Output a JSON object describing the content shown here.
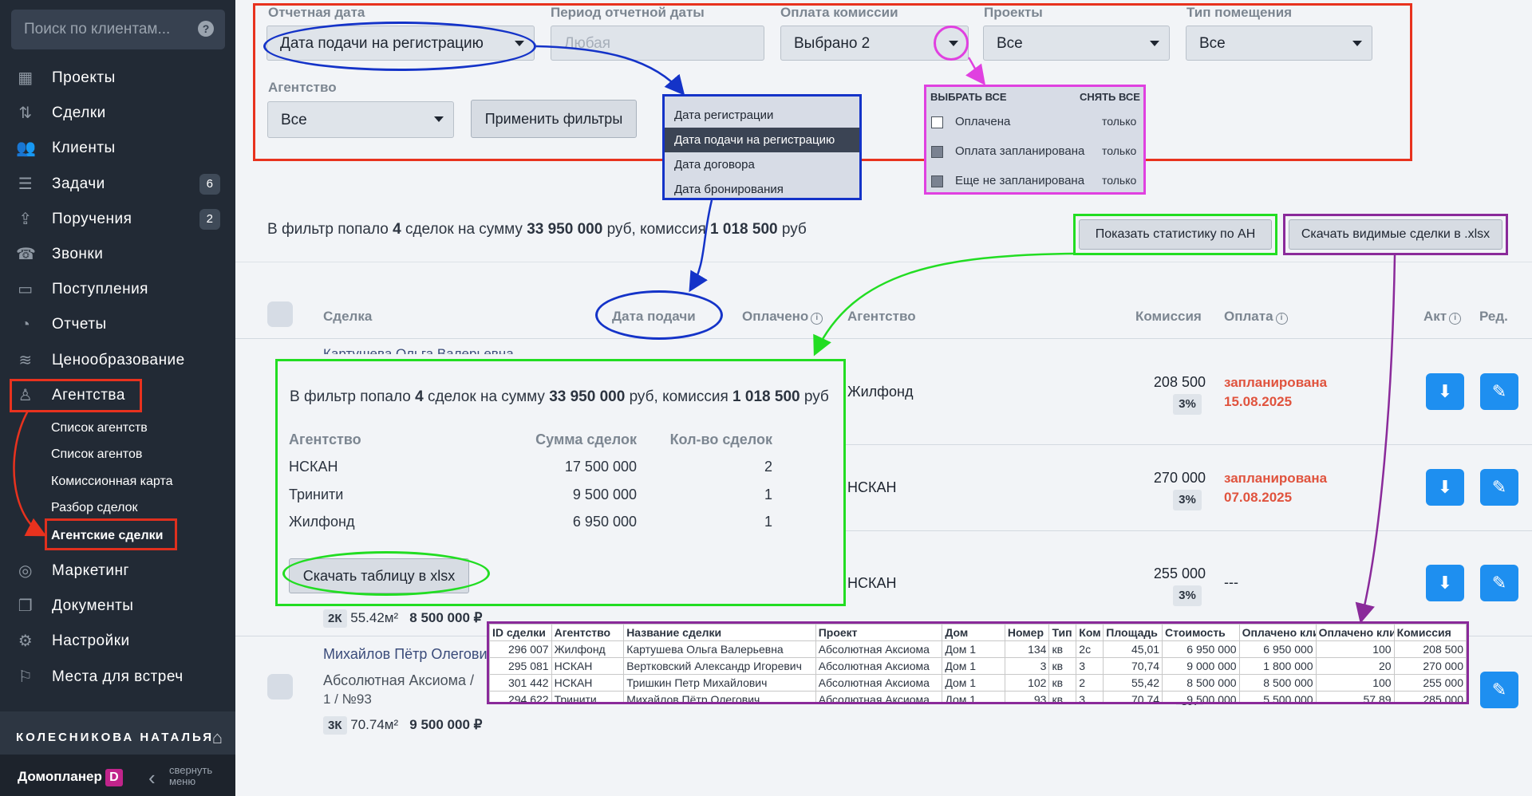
{
  "sidebar": {
    "search_placeholder": "Поиск по клиентам...",
    "help": "?",
    "items": [
      {
        "label": "Проекты",
        "icon": "grid-icon",
        "glyph": "▦"
      },
      {
        "label": "Сделки",
        "icon": "deals-icon",
        "glyph": "⇅"
      },
      {
        "label": "Клиенты",
        "icon": "users-icon",
        "glyph": "👥"
      },
      {
        "label": "Задачи",
        "icon": "tasks-icon",
        "glyph": "☰",
        "count": "6"
      },
      {
        "label": "Поручения",
        "icon": "inbox-icon",
        "glyph": "⇪",
        "count": "2"
      },
      {
        "label": "Звонки",
        "icon": "calls-icon",
        "glyph": "☎"
      },
      {
        "label": "Поступления",
        "icon": "wallet-icon",
        "glyph": "▭"
      },
      {
        "label": "Отчеты",
        "icon": "reports-icon",
        "glyph": "◔"
      },
      {
        "label": "Ценообразование",
        "icon": "coins-icon",
        "glyph": "≋"
      },
      {
        "label": "Агентства",
        "icon": "agency-icon",
        "glyph": "♙"
      }
    ],
    "agency_sub": [
      "Список агентств",
      "Список агентов",
      "Комиссионная карта",
      "Разбор сделок",
      "Агентские сделки"
    ],
    "items2": [
      {
        "label": "Маркетинг",
        "icon": "target-icon",
        "glyph": "◎"
      },
      {
        "label": "Документы",
        "icon": "documents-icon",
        "glyph": "❐"
      },
      {
        "label": "Настройки",
        "icon": "gear-icon",
        "glyph": "⚙"
      },
      {
        "label": "Места для встреч",
        "icon": "meeting-icon",
        "glyph": "⚐"
      }
    ],
    "user": "КОЛЕСНИКОВА НАТАЛЬЯ",
    "brand": "Домопланер",
    "brand_logo": "D",
    "collapse": "свернуть меню"
  },
  "filters": {
    "report_date_label": "Отчетная дата",
    "report_date_value": "Дата подачи на регистрацию",
    "period_label": "Период отчетной даты",
    "period_placeholder": "Любая",
    "commission_label": "Оплата комиссии",
    "commission_value": "Выбрано 2",
    "projects_label": "Проекты",
    "projects_value": "Все",
    "room_label": "Тип помещения",
    "room_value": "Все",
    "agency_label": "Агентство",
    "agency_value": "Все",
    "apply": "Применить фильтры"
  },
  "date_dropdown": [
    "Дата регистрации",
    "Дата подачи на регистрацию",
    "Дата договора",
    "Дата бронирования"
  ],
  "pay_dropdown": {
    "select_all": "ВЫБРАТЬ ВСЕ",
    "clear_all": "СНЯТЬ ВСЕ",
    "only": "только",
    "items": [
      "Оплачена",
      "Оплата запланирована",
      "Еще не запланирована"
    ]
  },
  "summary": {
    "pre": "В фильтр попало ",
    "count": "4",
    "mid": " сделок на сумму ",
    "sum": "33 950 000",
    "mid2": " руб, комиссия ",
    "commission": "1 018 500",
    "post": " руб"
  },
  "stats_btn": "Показать статистику по АН",
  "xlsx_btn": "Скачать видимые сделки в .xlsx",
  "columns": {
    "deal": "Сделка",
    "date": "Дата подачи",
    "paid": "Оплачено",
    "agency": "Агентство",
    "commission": "Комиссия",
    "payment": "Оплата",
    "act": "Акт",
    "edit": "Ред."
  },
  "rows": [
    {
      "agency": "Жилфонд",
      "commission": "208 500",
      "pct": "3%",
      "status": "запланирована",
      "date": "15.08.2025"
    },
    {
      "agency": "НСКАН",
      "commission": "270 000",
      "pct": "3%",
      "status": "запланирована",
      "date": "07.08.2025"
    },
    {
      "agency": "НСКАН",
      "commission": "255 000",
      "pct": "3%",
      "status": "---",
      "date": ""
    }
  ],
  "row0_name_partial": "Картушева Ольга Валерьевна",
  "row3": {
    "rooms": "2К",
    "area": "55.42м²",
    "price": "8 500 000 ₽"
  },
  "row4": {
    "name": "Михайлов Пётр Олегович",
    "project": "Абсолютная Аксиома   /",
    "sub": "1  /  №93",
    "rooms": "3К",
    "area": "70.74м²",
    "price": "9 500 000 ₽",
    "pct_partial": "3%"
  },
  "stats": {
    "headers": [
      "Агентство",
      "Сумма сделок",
      "Кол-во сделок"
    ],
    "rows": [
      [
        "НСКАН",
        "17 500 000",
        "2"
      ],
      [
        "Тринити",
        "9 500 000",
        "1"
      ],
      [
        "Жилфонд",
        "6 950 000",
        "1"
      ]
    ],
    "download": "Скачать таблицу в xlsx"
  },
  "xls": {
    "headers": [
      "ID сделки",
      "Агентство",
      "Название сделки",
      "Проект",
      "Дом",
      "Номер",
      "Тип",
      "Ком",
      "Площадь",
      "Стоимость",
      "Оплачено кли",
      "Оплачено кли",
      "Комиссия"
    ],
    "rows": [
      [
        "296 007",
        "Жилфонд",
        "Картушева Ольга Валерьевна",
        "Абсолютная Аксиома",
        "Дом 1",
        "134",
        "кв",
        "2с",
        "45,01",
        "6 950 000",
        "6 950 000",
        "100",
        "208 500"
      ],
      [
        "295 081",
        "НСКАН",
        "Вертковский Александр Игоревич",
        "Абсолютная Аксиома",
        "Дом 1",
        "3",
        "кв",
        "3",
        "70,74",
        "9 000 000",
        "1 800 000",
        "20",
        "270 000"
      ],
      [
        "301 442",
        "НСКАН",
        "Тришкин Петр Михайлович",
        "Абсолютная Аксиома",
        "Дом 1",
        "102",
        "кв",
        "2",
        "55,42",
        "8 500 000",
        "8 500 000",
        "100",
        "255 000"
      ],
      [
        "294 622",
        "Тринити",
        "Михайлов Пётр Олегович",
        "Абсолютная Аксиома",
        "Дом 1",
        "93",
        "кв",
        "3",
        "70,74",
        "9 500 000",
        "5 500 000",
        "57,89",
        "285 000"
      ]
    ]
  },
  "colors": {
    "red": "#e8321e",
    "blue": "#1433c8",
    "magenta": "#e040e0",
    "green": "#22dd22",
    "purple": "#8a2a9a",
    "accent": "#1e8ff0"
  }
}
